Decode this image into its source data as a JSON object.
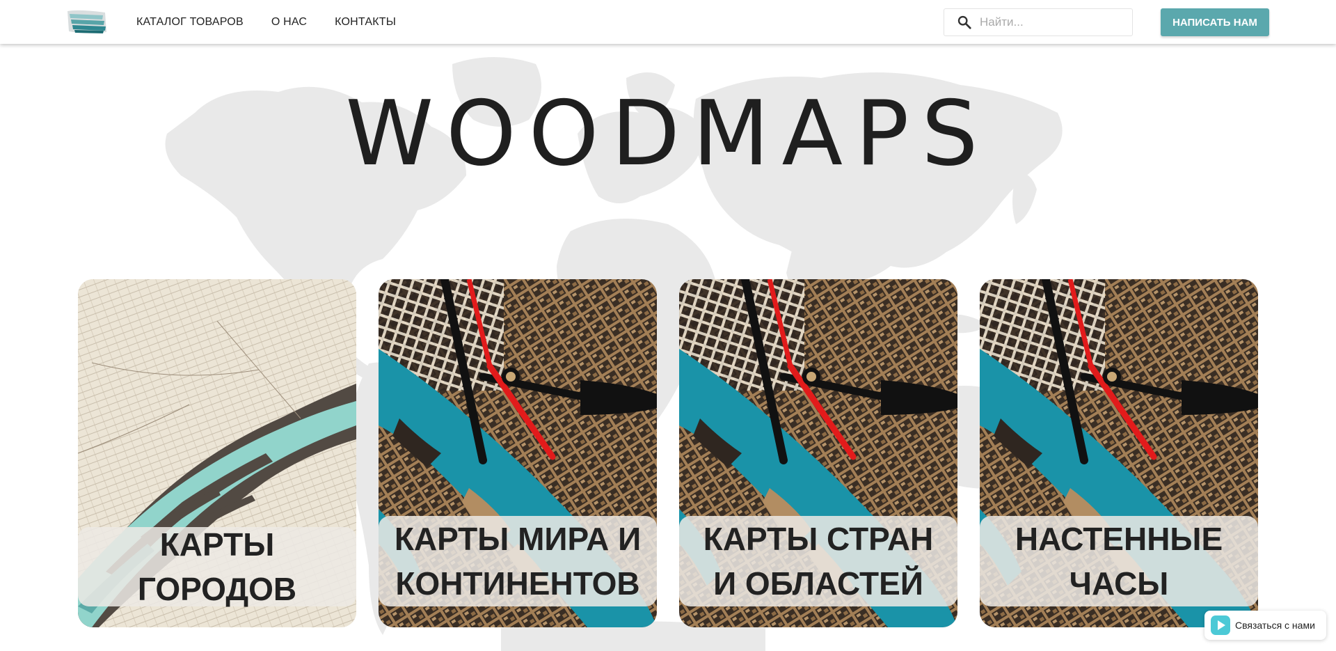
{
  "header": {
    "logo_alt": "WOODMAPS",
    "nav": [
      {
        "label": "КАТАЛОГ ТОВАРОВ"
      },
      {
        "label": "О НАС"
      },
      {
        "label": "КОНТАКТЫ"
      }
    ],
    "search": {
      "placeholder": "Найти...",
      "value": ""
    },
    "cta_label": "НАПИСАТЬ НАМ"
  },
  "hero": {
    "title": "WOODMAPS"
  },
  "cards": [
    {
      "label": "КАРТЫ ГОРОДОВ",
      "image": "city-relief-map"
    },
    {
      "label": "КАРТЫ МИРА И КОНТИНЕНТОВ",
      "image": "wooden-map-clock"
    },
    {
      "label": "КАРТЫ СТРАН И ОБЛАСТЕЙ",
      "image": "wooden-map-clock"
    },
    {
      "label": "НАСТЕННЫЕ ЧАСЫ",
      "image": "wooden-map-clock"
    }
  ],
  "chat_widget": {
    "label": "Связаться с нами",
    "icon": "chat-play-icon"
  },
  "colors": {
    "accent": "#5ba8ad",
    "title": "#1f1f1f",
    "water": "#1a93a8",
    "wood": "#b28d62"
  }
}
